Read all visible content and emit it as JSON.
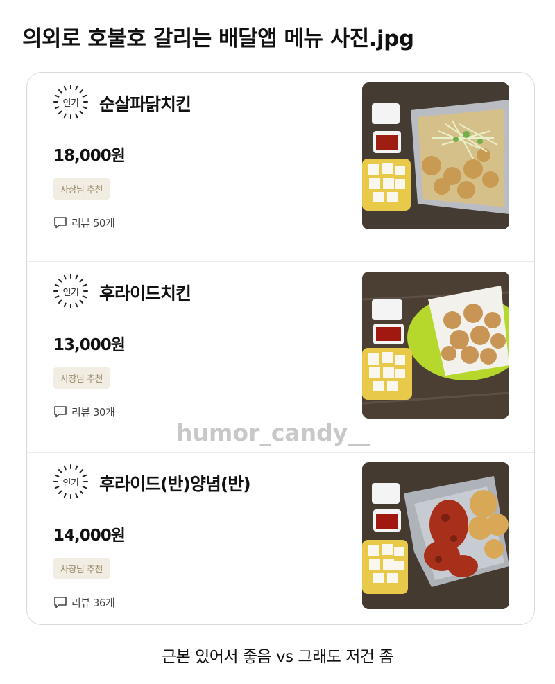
{
  "post": {
    "title": "의외로 호불호 갈리는 배달앱 메뉴 사진.jpg",
    "caption": "근본 있어서 좋음 vs 그래도 저건 좀",
    "watermark": "humor_candy__"
  },
  "menu": {
    "items": [
      {
        "badge": "인기",
        "name": "순살파닭치킨",
        "price": "18,000원",
        "tag": "사장님 추천",
        "review": "리뷰 50개",
        "photo_desc": "boneless chicken with green onion salad, pickled radish, dipping sauce"
      },
      {
        "badge": "인기",
        "name": "후라이드치킨",
        "price": "13,000원",
        "tag": "사장님 추천",
        "review": "리뷰 30개",
        "photo_desc": "fried chicken on a green plate, pickled radish, dipping sauce"
      },
      {
        "badge": "인기",
        "name": "후라이드(반)양념(반)",
        "price": "14,000원",
        "tag": "사장님 추천",
        "review": "리뷰 36개",
        "photo_desc": "half fried half seasoned chicken on foil, pickled radish, dipping sauce"
      }
    ]
  },
  "icons": {
    "badge": "sunburst-badge-icon",
    "review": "speech-bubble-icon"
  },
  "colors": {
    "tag_bg": "#f2ede2",
    "tag_text": "#9a8a6a",
    "card_border": "#d9d9d9",
    "watermark": "#c8c8c8"
  }
}
